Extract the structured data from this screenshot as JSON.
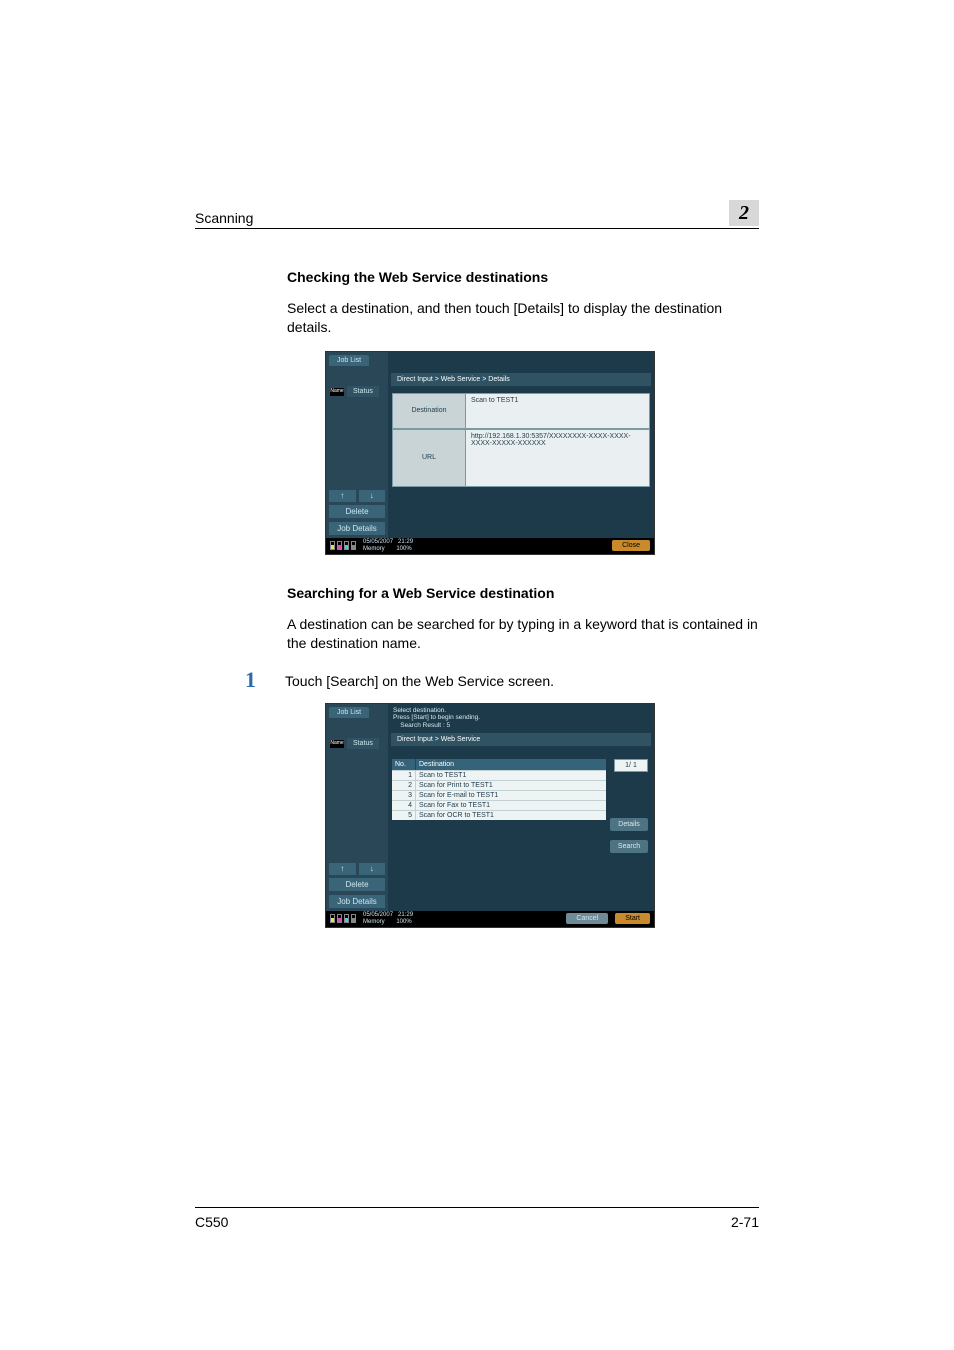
{
  "header": {
    "title": "Scanning",
    "chapter": "2"
  },
  "section1": {
    "heading": "Checking the Web Service destinations",
    "body": "Select a destination, and then touch [Details] to display the destination details."
  },
  "ss1": {
    "jobList": "Job List",
    "status": "Status",
    "nameIcon": "Name",
    "breadcrumb": "Direct Input > Web Service > Details",
    "destLabel": "Destination",
    "destValue": "Scan to TEST1",
    "urlLabel": "URL",
    "urlValue": "http://192.168.1.30:5357/XXXXXXXX-XXXX-XXXX-XXXX-XXXXX-XXXXXX",
    "upIcon": "↑",
    "downIcon": "↓",
    "delete": "Delete",
    "jobDetails": "Job Details",
    "date": "05/05/2007",
    "time": "21:29",
    "memoryLabel": "Memory",
    "memoryVal": "100%",
    "close": "Close"
  },
  "section2": {
    "heading": "Searching for a Web Service destination",
    "body": "A destination can be searched for by typing in a keyword that is contained in the destination name."
  },
  "step1": {
    "num": "1",
    "text": "Touch [Search] on the Web Service screen."
  },
  "ss2": {
    "jobList": "Job List",
    "status": "Status",
    "nameIcon": "Name",
    "promptLine1": "Select destination.",
    "promptLine2": "Press [Start] to begin sending.",
    "promptLine3": "Search Result  :   5",
    "breadcrumb": "Direct Input > Web Service",
    "thNo": "No.",
    "thDest": "Destination",
    "rows": [
      {
        "no": "1",
        "dest": "Scan to TEST1"
      },
      {
        "no": "2",
        "dest": "Scan for Print to TEST1"
      },
      {
        "no": "3",
        "dest": "Scan for E-mail to TEST1"
      },
      {
        "no": "4",
        "dest": "Scan for Fax to TEST1"
      },
      {
        "no": "5",
        "dest": "Scan for OCR to TEST1"
      }
    ],
    "pager": "1/  1",
    "details": "Details",
    "search": "Search",
    "upIcon": "↑",
    "downIcon": "↓",
    "delete": "Delete",
    "jobDetails": "Job Details",
    "date": "05/05/2007",
    "time": "21:29",
    "memoryLabel": "Memory",
    "memoryVal": "100%",
    "cancel": "Cancel",
    "start": "Start"
  },
  "footer": {
    "model": "C550",
    "page": "2-71"
  }
}
